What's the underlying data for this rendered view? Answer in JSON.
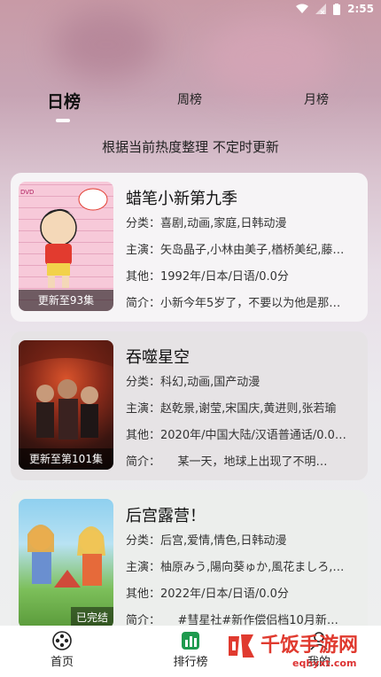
{
  "status_bar": {
    "time": "2:55"
  },
  "tabs": [
    {
      "label": "日榜"
    },
    {
      "label": "周榜"
    },
    {
      "label": "月榜"
    }
  ],
  "subtitle": "根据当前热度整理 不定时更新",
  "items": [
    {
      "title": "蜡笔小新第九季",
      "badge": "更新至93集",
      "genre": "分类：喜剧,动画,家庭,日韩动漫",
      "cast": "主演：矢岛晶子,小林由美子,楢桥美纪,藤…",
      "other": "其他：1992年/日本/日语/0.0分",
      "intro": "简介：小新今年5岁了，不要以为他是那…"
    },
    {
      "title": "吞噬星空",
      "badge": "更新至第101集",
      "genre": "分类：科幻,动画,国产动漫",
      "cast": "主演：赵乾景,谢莹,宋国庆,黄进则,张若瑜",
      "other": "其他：2020年/中国大陆/汉语普通话/0.0…",
      "intro": "简介：　　某一天，地球上出现了不明…"
    },
    {
      "title": "后宫露营！",
      "badge": "已完结",
      "genre": "分类：后宫,爱情,情色,日韩动漫",
      "cast": "主演：柚原みう,陽向葵ゅか,風花ましろ,…",
      "other": "其他：2022年/日本/日语/0.0分",
      "intro": "简介：　　#彗星社#新作偿侣档10月新…"
    }
  ],
  "bottom_nav": [
    {
      "label": "首页"
    },
    {
      "label": "排行榜"
    },
    {
      "label": "我的"
    }
  ],
  "watermark": {
    "text": "千饭手游网",
    "url": "eqhyxt.com"
  },
  "colors": {
    "accent_red": "#e03a2f"
  }
}
